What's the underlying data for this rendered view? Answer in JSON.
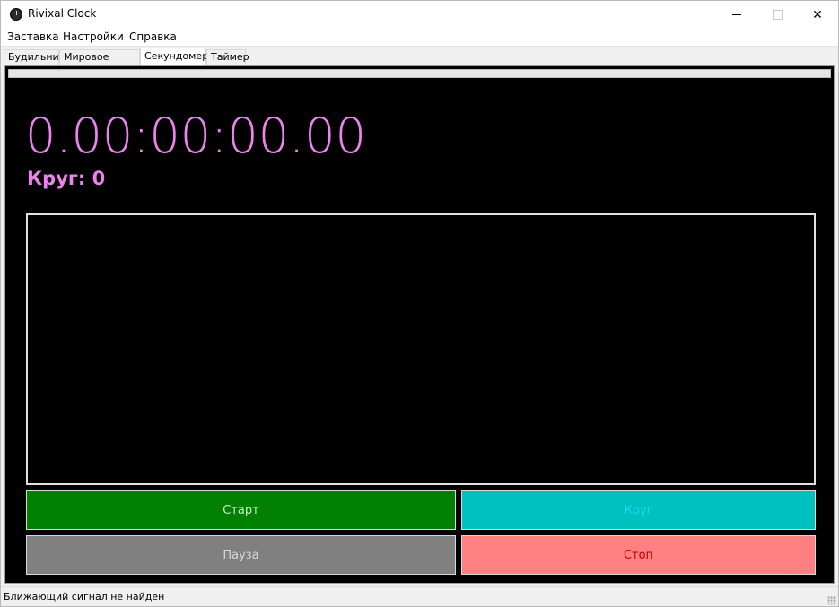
{
  "window": {
    "title": "Rivixal Clock"
  },
  "menu": {
    "items": [
      "Заставка",
      "Настройки",
      "Справка"
    ]
  },
  "tabs": [
    {
      "label": "Будильник",
      "active": false
    },
    {
      "label": "Мировое время",
      "active": false
    },
    {
      "label": "Секундомер",
      "active": true
    },
    {
      "label": "Таймер",
      "active": false
    }
  ],
  "stopwatch": {
    "time": "0.00:00:00.00",
    "lap_label": "Круг: 0",
    "progress": 0,
    "laps": []
  },
  "buttons": {
    "start": "Старт",
    "lap": "Круг",
    "pause": "Пауза",
    "stop": "Стоп"
  },
  "colors": {
    "accent_text": "#ee82ee",
    "start_bg": "#008000",
    "lap_bg": "#00c0c0",
    "pause_bg": "#808080",
    "stop_bg": "#ff8080"
  },
  "status": {
    "text": "Ближающий сигнал не найден"
  }
}
